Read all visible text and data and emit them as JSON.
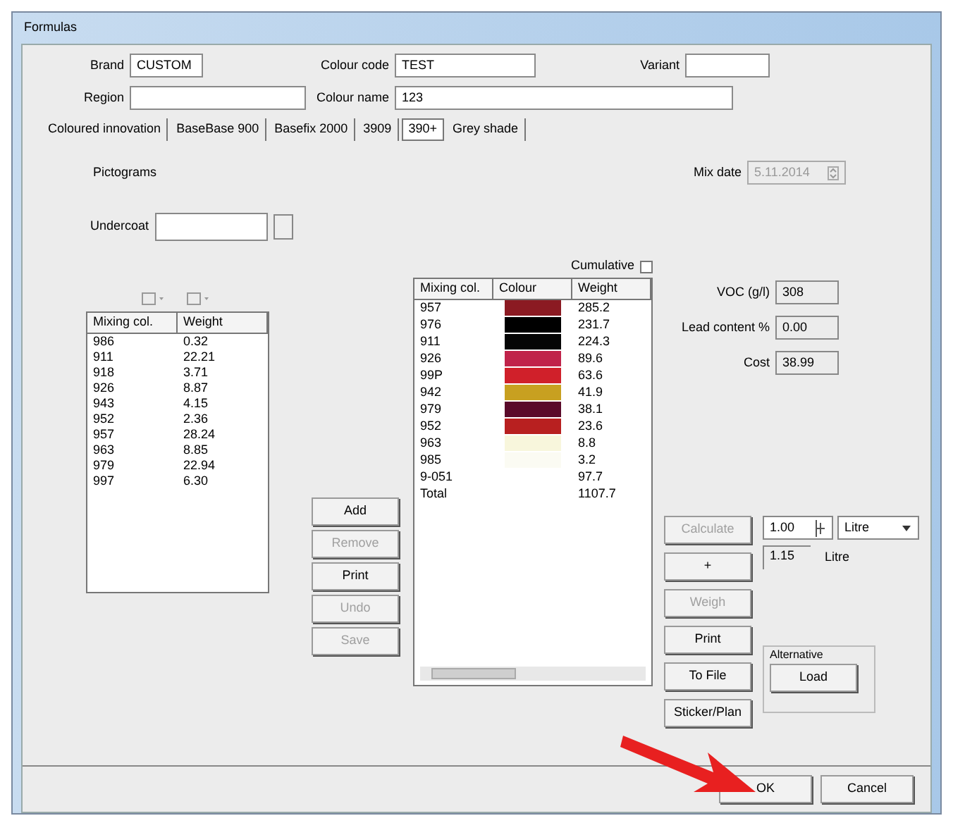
{
  "window": {
    "title": "Formulas"
  },
  "header_fields": [
    {
      "label": "Brand",
      "value": "CUSTOM"
    },
    {
      "label": "Colour code",
      "value": "TEST"
    },
    {
      "label": "Variant"
    },
    {
      "label": "Region"
    },
    {
      "label": "Colour name",
      "value": "123"
    }
  ],
  "tabs": [
    {
      "label": "Coloured innovation",
      "selected": false
    },
    {
      "label": "BaseBase 900",
      "selected": false
    },
    {
      "label": "Basefix 2000",
      "selected": false
    },
    {
      "label": "3909",
      "selected": false
    },
    {
      "label": "390+",
      "selected": true
    },
    {
      "label": "Grey shade",
      "selected": false
    }
  ],
  "pictograms_label": "Pictograms",
  "mix_date": {
    "label": "Mix date",
    "value": "5.11.2014",
    "disabled": true
  },
  "undercoat": {
    "label": "Undercoat"
  },
  "cumulative": {
    "label": "Cumulative",
    "checked": false
  },
  "left_table": {
    "columns": [
      "Mixing col.",
      "Weight"
    ],
    "rows": [
      [
        "986",
        "0.32"
      ],
      [
        "911",
        "22.21"
      ],
      [
        "918",
        "3.71"
      ],
      [
        "926",
        "8.87"
      ],
      [
        "943",
        "4.15"
      ],
      [
        "952",
        "2.36"
      ],
      [
        "957",
        "28.24"
      ],
      [
        "963",
        "8.85"
      ],
      [
        "979",
        "22.94"
      ],
      [
        "997",
        "6.30"
      ]
    ]
  },
  "middle_buttons": [
    {
      "label": "Add",
      "disabled": false
    },
    {
      "label": "Remove",
      "disabled": true
    },
    {
      "label": "Print",
      "disabled": false
    },
    {
      "label": "Undo",
      "disabled": true
    },
    {
      "label": "Save",
      "disabled": true
    }
  ],
  "mix_table": {
    "columns": [
      "Mixing col.",
      "Colour",
      "Weight"
    ],
    "rows": [
      {
        "code": "957",
        "color": "#8b1a22",
        "weight": "285.2"
      },
      {
        "code": "976",
        "color": "#000000",
        "weight": "231.7"
      },
      {
        "code": "911",
        "color": "#050505",
        "weight": "224.3"
      },
      {
        "code": "926",
        "color": "#c0234a",
        "weight": "89.6"
      },
      {
        "code": "99P",
        "color": "#d0202a",
        "weight": "63.6"
      },
      {
        "code": "942",
        "color": "#c8a020",
        "weight": "41.9"
      },
      {
        "code": "979",
        "color": "#5a0a2a",
        "weight": "38.1"
      },
      {
        "code": "952",
        "color": "#b82020",
        "weight": "23.6"
      },
      {
        "code": "963",
        "color": "#f8f6dc",
        "weight": "8.8"
      },
      {
        "code": "985",
        "color": "#fbfbf3",
        "weight": "3.2"
      },
      {
        "code": "9-051",
        "weight": "97.7"
      },
      {
        "code": "Total",
        "weight": "1107.7"
      }
    ]
  },
  "info_fields": [
    {
      "label": "VOC (g/l)",
      "value": "308"
    },
    {
      "label": "Lead content %",
      "value": "0.00"
    },
    {
      "label": "Cost",
      "value": "38.99"
    }
  ],
  "right_buttons": [
    {
      "label": "Calculate",
      "disabled": true
    },
    {
      "label": "+",
      "disabled": false
    },
    {
      "label": "Weigh",
      "disabled": true
    },
    {
      "label": "Print",
      "disabled": false
    },
    {
      "label": "To File",
      "disabled": false
    },
    {
      "label": "Sticker/Plan",
      "disabled": false
    }
  ],
  "quantity": {
    "value": "1.00",
    "unit": "Litre",
    "result": "1.15",
    "result_unit": "Litre"
  },
  "alternative": {
    "title": "Alternative",
    "button": "Load"
  },
  "footer_buttons": [
    "OK",
    "Cancel"
  ]
}
